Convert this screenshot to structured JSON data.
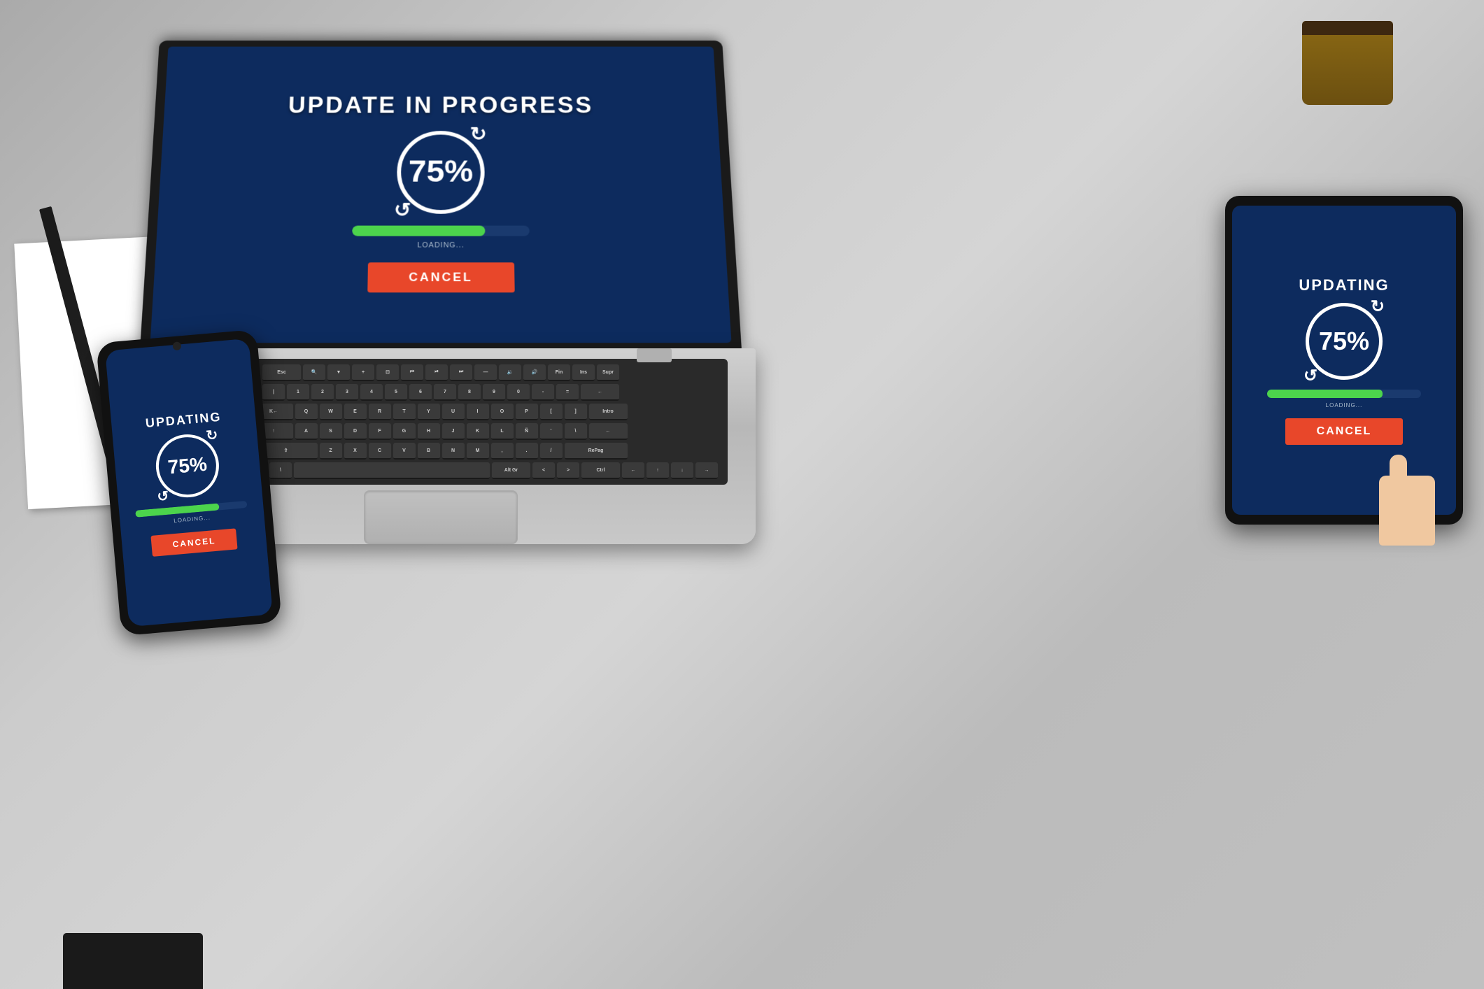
{
  "background": {
    "color": "#c5c5c5"
  },
  "laptop": {
    "screen_title": "UPDATE IN PROGRESS",
    "percent": "75%",
    "loading_label": "LOADING...",
    "cancel_label": "CANCEL",
    "progress": 75
  },
  "phone": {
    "title": "UPDATING",
    "percent": "75%",
    "loading_label": "LOADING...",
    "cancel_label": "CANCEL",
    "progress": 75
  },
  "tablet": {
    "title": "UPDATING",
    "percent": "75%",
    "loading_label": "LOADING...",
    "cancel_label": "CANCEL",
    "progress": 75
  },
  "colors": {
    "screen_bg": "#0d2b5e",
    "progress_fill": "#4cd44c",
    "cancel_bg": "#e8472a",
    "device_body": "#111111"
  }
}
